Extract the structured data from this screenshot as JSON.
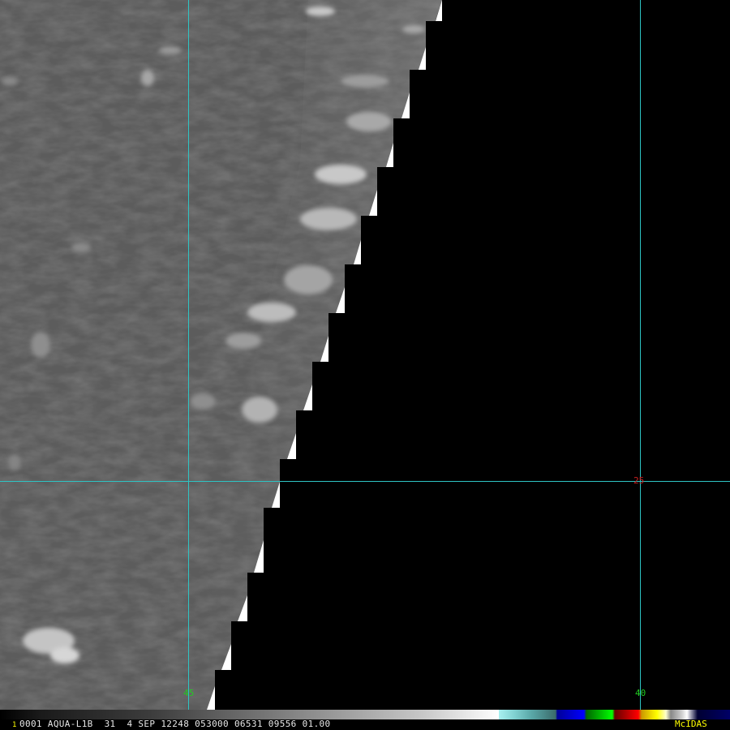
{
  "map": {
    "satellite": "AQUA-L1B",
    "band": "31",
    "grid_color": "#2ec4c4",
    "longitude_labels": [
      {
        "text": "45",
        "color": "#22cc22"
      },
      {
        "text": "40",
        "color": "#22cc22"
      }
    ],
    "latitude_labels": [
      {
        "text": "25",
        "color": "#cc2222"
      }
    ],
    "terrain_color": "#5e5e5e",
    "no_data_color": "#000000"
  },
  "status_bar": {
    "frame_number": "1",
    "text": "0001 AQUA-L1B  31  4 SEP 12248 053000 06531 09556 01.00",
    "brand": "McIDAS",
    "brand_color": "#ffff00"
  }
}
